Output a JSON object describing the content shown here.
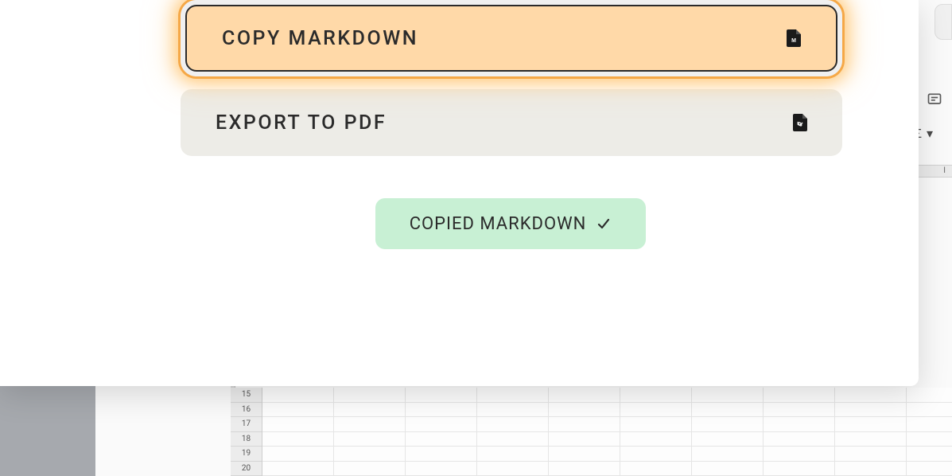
{
  "modal": {
    "options": [
      {
        "label": "COPY MARKDOWN",
        "icon": "markdown"
      },
      {
        "label": "EXPORT TO PDF",
        "icon": "pdf"
      }
    ]
  },
  "toast": {
    "label": "COPIED MARKDOWN"
  },
  "spreadsheet": {
    "sigma_label": "Σ",
    "visible_rows": [
      "15",
      "16",
      "17",
      "18",
      "19",
      "20"
    ],
    "col_label": "I"
  },
  "colors": {
    "highlight_bg": "#ffd9a8",
    "highlight_glow": "#f5a847",
    "normal_bg": "#edece7",
    "toast_bg": "#c8f0d4"
  }
}
